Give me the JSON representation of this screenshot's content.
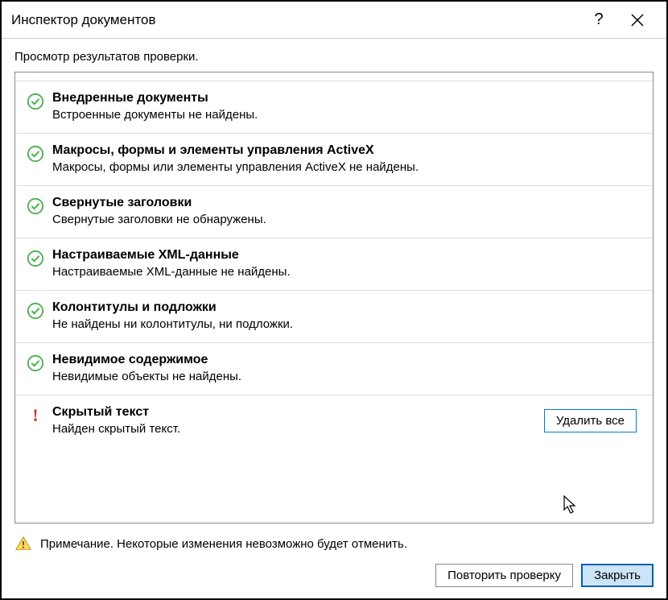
{
  "titlebar": {
    "title": "Инспектор документов"
  },
  "subtitle": "Просмотр результатов проверки.",
  "results": [
    {
      "status": "ok",
      "title": "Внедренные документы",
      "desc": "Встроенные документы не найдены."
    },
    {
      "status": "ok",
      "title": "Макросы, формы и элементы управления ActiveX",
      "desc": "Макросы, формы или элементы управления ActiveX не найдены."
    },
    {
      "status": "ok",
      "title": "Свернутые заголовки",
      "desc": "Свернутые заголовки не обнаружены."
    },
    {
      "status": "ok",
      "title": "Настраиваемые XML-данные",
      "desc": "Настраиваемые XML-данные не найдены."
    },
    {
      "status": "ok",
      "title": "Колонтитулы и подложки",
      "desc": "Не найдены ни колонтитулы, ни подложки."
    },
    {
      "status": "ok",
      "title": "Невидимое содержимое",
      "desc": "Невидимые объекты не найдены."
    },
    {
      "status": "warn",
      "title": "Скрытый текст",
      "desc": "Найден скрытый текст.",
      "action": "Удалить все"
    }
  ],
  "footer": {
    "note": "Примечание. Некоторые изменения невозможно будет отменить.",
    "reinspect": "Повторить проверку",
    "close": "Закрыть"
  }
}
